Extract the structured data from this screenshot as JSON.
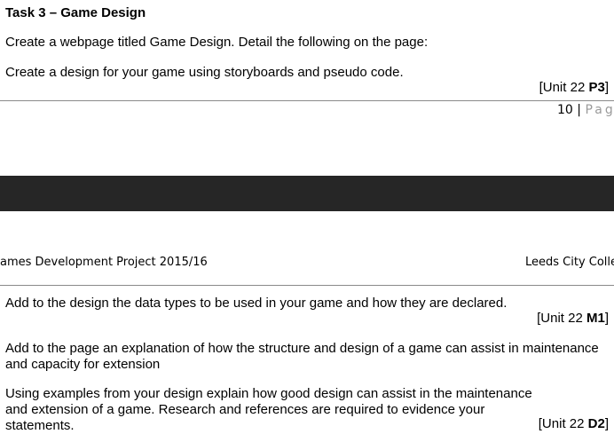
{
  "page1": {
    "task_title": "Task 3 – Game Design",
    "para1": "Create a webpage titled Game Design. Detail the following on the page:",
    "para2": "Create a design for your game using storyboards and pseudo code.",
    "unit_ref": {
      "prefix": "[Unit 22 ",
      "grade": "P3",
      "suffix": "]"
    },
    "footer": {
      "page_number": "10",
      "separator": " | ",
      "page_label": "Pag"
    }
  },
  "page_break": {
    "band_color": "#262626"
  },
  "page2": {
    "header_left": "ames Development Project 2015/16",
    "header_right": "Leeds City Colleg",
    "para1": "Add to the design the data types to be used in your game and how they are declared.",
    "unit_ref1": {
      "prefix": "[Unit 22 ",
      "grade": "M1",
      "suffix": "]"
    },
    "para2": "Add to the page an explanation of how the structure and design of a game can assist in maintenance and capacity for extension",
    "para3": "Using examples from your design explain how good design can assist in the maintenance and extension of a game. Research and references are required to evidence your statements.",
    "unit_ref2": {
      "prefix": "[Unit 22 ",
      "grade": "D2",
      "suffix": "]"
    }
  }
}
